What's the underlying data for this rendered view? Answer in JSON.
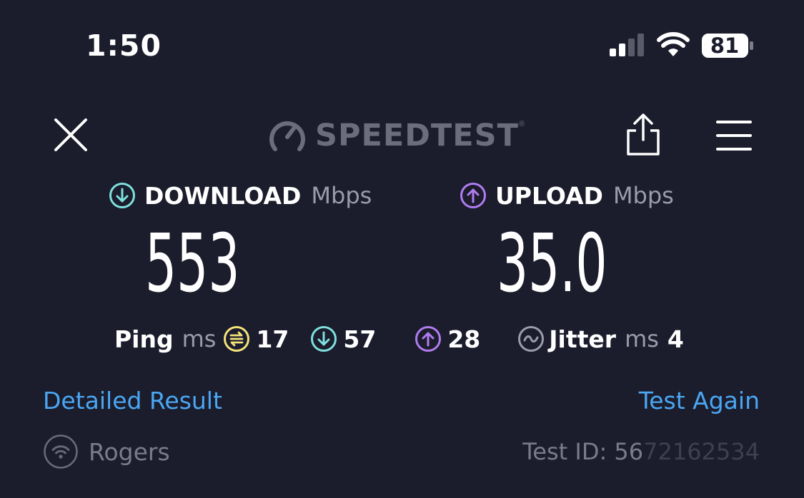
{
  "status_bar": {
    "time": "1:50",
    "battery": "81",
    "icons": [
      "cellular-signal-icon",
      "wifi-icon",
      "battery-icon"
    ]
  },
  "header": {
    "brand": "SPEEDTEST",
    "trademark": "®",
    "icons": [
      "close-icon",
      "speedometer-icon",
      "share-icon",
      "menu-icon"
    ]
  },
  "download": {
    "label": "DOWNLOAD",
    "unit": "Mbps",
    "value": "553",
    "color": "#7ee0dd"
  },
  "upload": {
    "label": "UPLOAD",
    "unit": "Mbps",
    "value": "35.0",
    "color": "#b07cf0"
  },
  "latency": {
    "ping_label": "Ping",
    "ping_unit": "ms",
    "idle": "17",
    "download": "57",
    "upload": "28",
    "jitter_label": "Jitter",
    "jitter_unit": "ms",
    "jitter": "4",
    "idle_color": "#f3e37a"
  },
  "links": {
    "detailed": "Detailed Result",
    "again": "Test Again",
    "color": "#4aa7f2"
  },
  "footer": {
    "isp": "Rogers",
    "test_id_label": "Test ID: ",
    "test_id_visible": "56",
    "test_id_faded": "72162534"
  }
}
